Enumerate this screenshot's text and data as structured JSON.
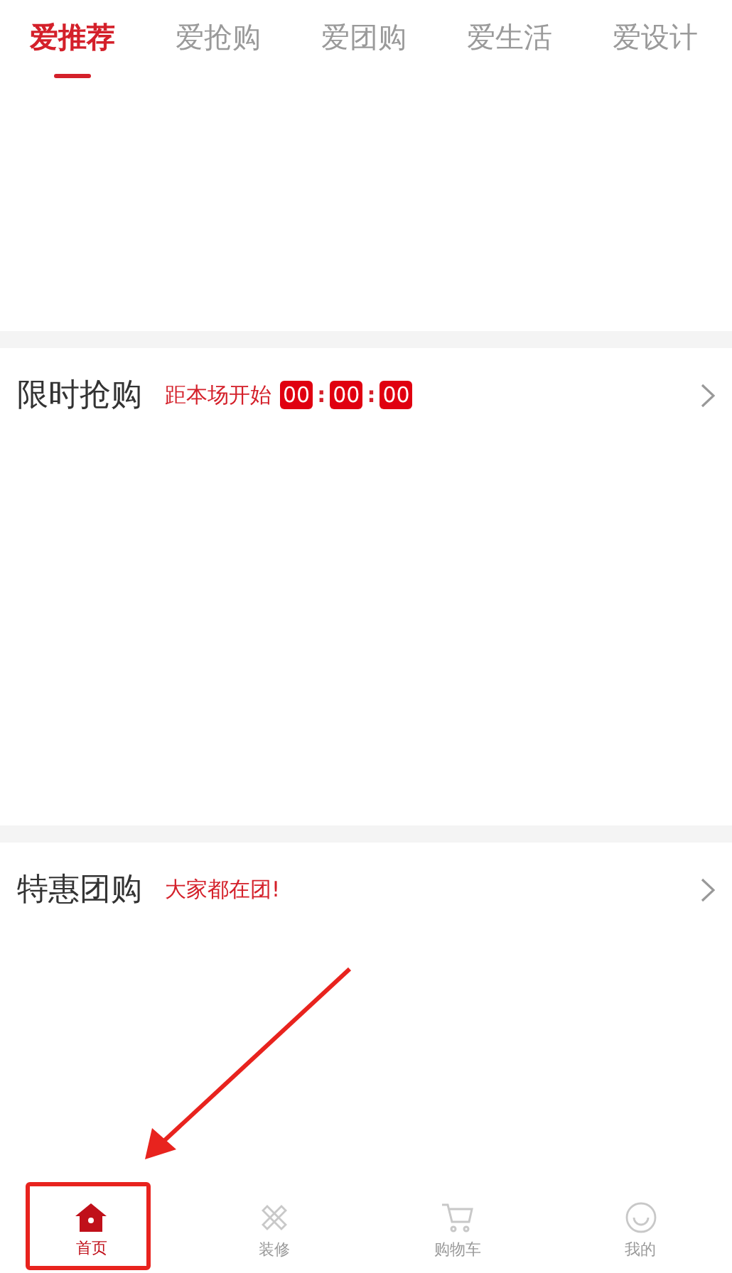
{
  "tabs": [
    {
      "label": "爱推荐",
      "selected": true
    },
    {
      "label": "爱抢购",
      "selected": false
    },
    {
      "label": "爱团购",
      "selected": false
    },
    {
      "label": "爱生活",
      "selected": false
    },
    {
      "label": "爱设计",
      "selected": false
    }
  ],
  "sections": [
    {
      "kind": "countdown",
      "title": "限时抢购",
      "subtitle": "距本场开始",
      "timer": [
        "00",
        ":",
        "00",
        ":",
        "00"
      ]
    },
    {
      "kind": "promo",
      "title": "特惠团购",
      "subtitle": "大家都在团!"
    }
  ],
  "bottom_nav": [
    {
      "label": "首页",
      "selected": true
    },
    {
      "label": "装修",
      "selected": false
    },
    {
      "label": "购物车",
      "selected": false
    },
    {
      "label": "我的",
      "selected": false
    }
  ],
  "annotation": {
    "highlight_box": true,
    "arrow": true
  }
}
